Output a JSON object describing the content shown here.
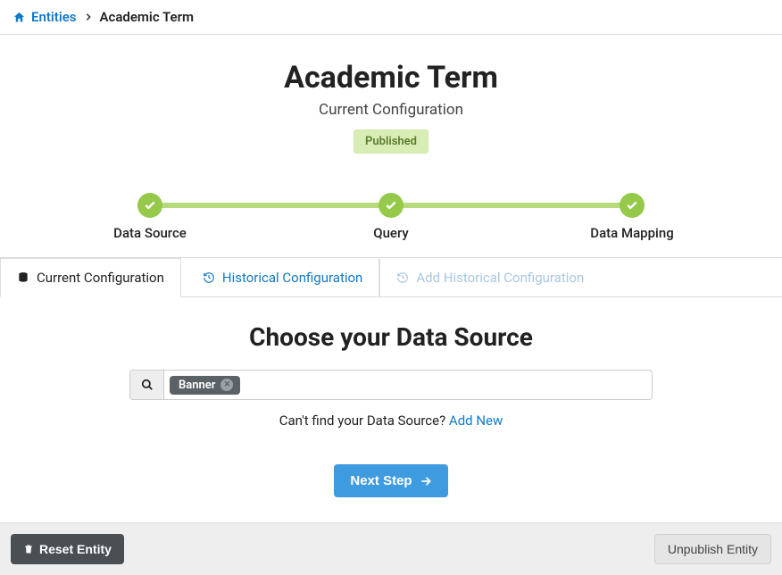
{
  "breadcrumb": {
    "root": "Entities",
    "current": "Academic Term"
  },
  "header": {
    "title": "Academic Term",
    "subtitle": "Current Configuration",
    "status": "Published"
  },
  "stepper": {
    "steps": [
      {
        "label": "Data Source",
        "completed": true
      },
      {
        "label": "Query",
        "completed": true
      },
      {
        "label": "Data Mapping",
        "completed": true
      }
    ]
  },
  "tabs": {
    "current": "Current Configuration",
    "historical": "Historical Configuration",
    "add_historical": "Add Historical Configuration"
  },
  "section": {
    "title": "Choose your Data Source",
    "selected_chip": "Banner",
    "hint_prefix": "Can't find your Data Source? ",
    "hint_link": "Add New"
  },
  "actions": {
    "next": "Next Step",
    "reset": "Reset Entity",
    "unpublish": "Unpublish Entity"
  }
}
